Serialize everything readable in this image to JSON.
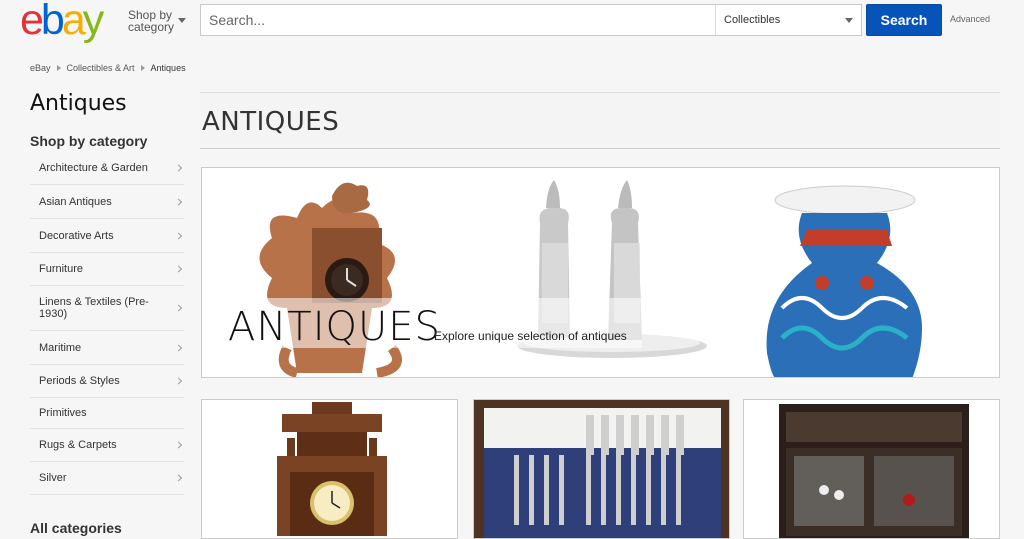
{
  "header": {
    "logo_letters": [
      {
        "ch": "e",
        "color": "#e53238"
      },
      {
        "ch": "b",
        "color": "#0064d2"
      },
      {
        "ch": "a",
        "color": "#f5af02"
      },
      {
        "ch": "y",
        "color": "#86b817"
      }
    ],
    "shop_by_line1": "Shop by",
    "shop_by_line2": "category",
    "search_placeholder": "Search...",
    "category_select": "Collectibles",
    "search_button": "Search",
    "advanced": "Advanced"
  },
  "breadcrumb": [
    "eBay",
    "Collectibles & Art",
    "Antiques"
  ],
  "sidebar": {
    "title": "Antiques",
    "subtitle": "Shop by category",
    "items": [
      {
        "label": "Architecture & Garden",
        "chevron": true
      },
      {
        "label": "Asian Antiques",
        "chevron": true
      },
      {
        "label": "Decorative Arts",
        "chevron": true
      },
      {
        "label": "Furniture",
        "chevron": true
      },
      {
        "label": "Linens & Textiles (Pre-1930)",
        "chevron": true
      },
      {
        "label": "Maritime",
        "chevron": true
      },
      {
        "label": "Periods & Styles",
        "chevron": true
      },
      {
        "label": "Primitives",
        "chevron": false
      },
      {
        "label": "Rugs & Carpets",
        "chevron": true
      },
      {
        "label": "Silver",
        "chevron": true
      }
    ],
    "all_categories": "All categories"
  },
  "main": {
    "title": "ANTIQUES",
    "hero_title": "ANTIQUES",
    "hero_subtitle": "Explore unique selection of antiques"
  },
  "colors": {
    "accent": "#0654ba"
  }
}
